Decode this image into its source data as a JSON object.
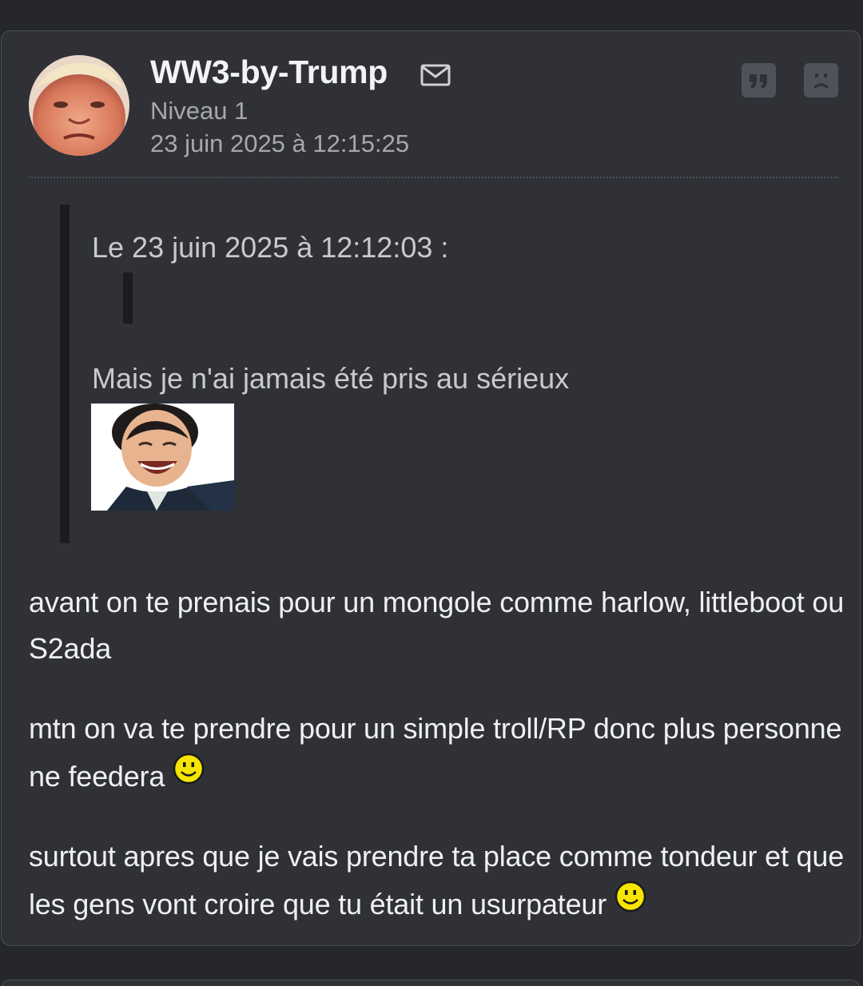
{
  "post": {
    "author": {
      "name": "WW3-by-Trump",
      "level": "Niveau 1",
      "avatar_icon": "avatar-portrait"
    },
    "date": "23 juin 2025 à 12:15:25",
    "actions": {
      "mail_icon": "envelope-icon",
      "quote_icon": "quote-icon",
      "report_icon": "sad-face-icon"
    },
    "quote": {
      "header": "Le 23 juin 2025 à 12:12:03 :",
      "text": "Mais je n'ai jamais été pris au sérieux",
      "sticker_icon": "laughing-man-sticker"
    },
    "paragraphs": [
      {
        "text": "avant on te prenais pour un mongole comme harlow, littleboot ou S2ada"
      },
      {
        "text": "mtn on va te prendre pour un simple troll/RP donc plus personne ne feedera"
      },
      {
        "text": "surtout apres que je vais prendre ta place comme tondeur et que les gens vont croire que tu était un usurpateur"
      }
    ],
    "emoji_icon": "smiley-icon"
  },
  "colors": {
    "page_bg": "#25272c",
    "card_bg": "#2f3137",
    "card_border": "#4a4d55",
    "text_primary": "#eef0f3",
    "text_muted": "#a6a8ae",
    "quote_bar": "#1b1c20",
    "action_button": "#4f5259",
    "smiley_yellow": "#f6e500"
  }
}
